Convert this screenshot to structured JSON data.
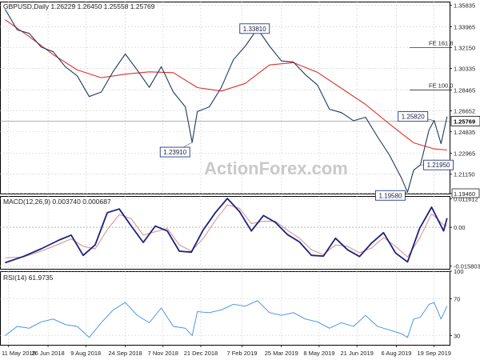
{
  "header": {
    "price_title": "GBPUSD,Daily  1.26229 1.26450 1.25558 1.25769",
    "macd_title": "MACD(12,26,9) 0.003740 0.000687",
    "rsi_title": "RSI(14) 61.9735"
  },
  "watermark": "ActionForex.com",
  "colors": {
    "price": "#1f3a5f",
    "sma": "#e0302a",
    "macd_line": "#1a237e",
    "macd_signal": "#d98b8b",
    "rsi": "#3a8ee6",
    "grid": "#cfcfcf",
    "label_border": "#1f3a8a"
  },
  "chart_data": [
    {
      "type": "line",
      "panel": "price",
      "title": "GBPUSD,Daily",
      "ohlc_last": {
        "open": 1.26229,
        "high": 1.2645,
        "low": 1.25558,
        "close": 1.25769
      },
      "ylim": [
        1.1946,
        1.3616
      ],
      "y_ticks": [
        "1.35835",
        "1.33965",
        "1.32150",
        "1.30335",
        "1.28465",
        "1.26652",
        "1.24835",
        "1.22965",
        "1.21150",
        "1.19460"
      ],
      "y_tick_values": [
        1.35835,
        1.33965,
        1.3215,
        1.30335,
        1.28465,
        1.26652,
        1.24835,
        1.22965,
        1.2115,
        1.1946
      ],
      "last_value_label": "1.25769",
      "x_tick_labels": [
        "11 May 2018",
        "26 Jun 2018",
        "9 Aug 2018",
        "24 Sep 2018",
        "7 Nov 2018",
        "21 Dec 2018",
        "7 Feb 2019",
        "25 Mar 2019",
        "8 May 2019",
        "21 Jun 2019",
        "6 Aug 2019",
        "19 Sep 2019"
      ],
      "x_tick_dates": [
        "2018-05-11",
        "2018-06-26",
        "2018-08-09",
        "2018-09-24",
        "2018-11-07",
        "2018-12-21",
        "2019-02-07",
        "2019-03-25",
        "2019-05-08",
        "2019-06-21",
        "2019-08-06",
        "2019-09-19"
      ],
      "series": [
        {
          "key": "price",
          "x": [
            "2018-05-07",
            "2018-05-21",
            "2018-06-04",
            "2018-06-18",
            "2018-07-02",
            "2018-07-16",
            "2018-07-30",
            "2018-08-13",
            "2018-08-27",
            "2018-09-10",
            "2018-09-24",
            "2018-10-08",
            "2018-10-22",
            "2018-11-05",
            "2018-11-19",
            "2018-12-03",
            "2018-12-11",
            "2018-12-17",
            "2018-12-31",
            "2019-01-14",
            "2019-01-28",
            "2019-02-11",
            "2019-02-25",
            "2019-03-11",
            "2019-03-25",
            "2019-04-08",
            "2019-04-22",
            "2019-05-06",
            "2019-05-20",
            "2019-06-03",
            "2019-06-17",
            "2019-07-01",
            "2019-07-15",
            "2019-07-29",
            "2019-08-12",
            "2019-08-19",
            "2019-08-26",
            "2019-09-03",
            "2019-09-13",
            "2019-09-19",
            "2019-09-27",
            "2019-10-04"
          ],
          "values": [
            1.355,
            1.337,
            1.334,
            1.322,
            1.318,
            1.305,
            1.297,
            1.279,
            1.283,
            1.301,
            1.316,
            1.302,
            1.287,
            1.305,
            1.283,
            1.27,
            1.2391,
            1.266,
            1.27,
            1.287,
            1.311,
            1.323,
            1.3381,
            1.323,
            1.31,
            1.309,
            1.298,
            1.289,
            1.268,
            1.265,
            1.258,
            1.261,
            1.244,
            1.228,
            1.208,
            1.1958,
            1.215,
            1.2195,
            1.25,
            1.2582,
            1.238,
            1.2615
          ]
        },
        {
          "key": "sma",
          "x": [
            "2018-05-07",
            "2018-06-04",
            "2018-07-02",
            "2018-07-30",
            "2018-08-27",
            "2018-09-24",
            "2018-10-22",
            "2018-11-19",
            "2018-12-17",
            "2019-01-14",
            "2019-02-11",
            "2019-03-11",
            "2019-04-08",
            "2019-05-06",
            "2019-06-03",
            "2019-07-01",
            "2019-07-29",
            "2019-08-26",
            "2019-09-19",
            "2019-10-04"
          ],
          "values": [
            1.3458,
            1.3312,
            1.3155,
            1.3022,
            1.2954,
            1.2985,
            1.3005,
            1.2998,
            1.2868,
            1.2838,
            1.2905,
            1.3065,
            1.3085,
            1.3001,
            1.2861,
            1.2722,
            1.2551,
            1.2388,
            1.2335,
            1.2325
          ]
        }
      ],
      "annotations": [
        {
          "label": "1.33810",
          "date": "2019-02-25",
          "value": 1.3381
        },
        {
          "label": "1.23910",
          "date": "2018-12-11",
          "value": 1.2391
        },
        {
          "label": "1.25820",
          "date": "2019-09-19",
          "value": 1.2582
        },
        {
          "label": "1.21950",
          "date": "2019-09-03",
          "value": 1.2195
        },
        {
          "label": "1.19580",
          "date": "2019-08-19",
          "value": 1.1958
        }
      ],
      "reference_lines": [
        {
          "label": "FE 161.8",
          "value": 1.3215
        },
        {
          "label": "FE 100.0",
          "value": 1.28465
        },
        {
          "label": "",
          "value": 1.1946,
          "style": "dashed"
        }
      ]
    },
    {
      "type": "line",
      "panel": "macd",
      "title": "MACD(12,26,9)",
      "last_values": {
        "macd": 0.00374,
        "signal": 0.000687
      },
      "ylim": [
        -0.017,
        0.0128
      ],
      "y_ticks": [
        "0.011612",
        "0.00",
        "-0.015803"
      ],
      "y_tick_values": [
        0.011612,
        0.0,
        -0.015803
      ],
      "series": [
        {
          "key": "macd",
          "x": [
            "2018-05-07",
            "2018-05-28",
            "2018-06-18",
            "2018-07-09",
            "2018-07-23",
            "2018-08-06",
            "2018-08-20",
            "2018-09-03",
            "2018-09-17",
            "2018-10-01",
            "2018-10-15",
            "2018-10-29",
            "2018-11-12",
            "2018-11-26",
            "2018-12-10",
            "2018-12-24",
            "2019-01-07",
            "2019-01-21",
            "2019-02-04",
            "2019-02-18",
            "2019-03-04",
            "2019-03-18",
            "2019-04-01",
            "2019-04-15",
            "2019-04-29",
            "2019-05-13",
            "2019-05-27",
            "2019-06-10",
            "2019-06-24",
            "2019-07-08",
            "2019-07-22",
            "2019-08-05",
            "2019-08-19",
            "2019-09-02",
            "2019-09-16",
            "2019-09-30",
            "2019-10-04"
          ],
          "values": [
            -0.0145,
            -0.012,
            -0.0088,
            -0.0052,
            -0.0032,
            -0.0115,
            -0.0072,
            0.006,
            0.0075,
            0.0005,
            -0.0062,
            0.0005,
            -0.0015,
            -0.0098,
            -0.0102,
            -0.001,
            0.006,
            0.0118,
            0.0065,
            -0.0015,
            0.0048,
            0.002,
            -0.003,
            -0.006,
            -0.0115,
            -0.0118,
            -0.0045,
            -0.0092,
            -0.012,
            -0.0065,
            -0.0022,
            -0.0105,
            -0.0142,
            -0.0005,
            0.0082,
            -0.0015,
            0.00374
          ]
        },
        {
          "key": "signal",
          "x": [
            "2018-05-07",
            "2018-05-28",
            "2018-06-18",
            "2018-07-09",
            "2018-07-23",
            "2018-08-06",
            "2018-08-20",
            "2018-09-03",
            "2018-09-17",
            "2018-10-01",
            "2018-10-15",
            "2018-10-29",
            "2018-11-12",
            "2018-11-26",
            "2018-12-10",
            "2018-12-24",
            "2019-01-07",
            "2019-01-21",
            "2019-02-04",
            "2019-02-18",
            "2019-03-04",
            "2019-03-18",
            "2019-04-01",
            "2019-04-15",
            "2019-04-29",
            "2019-05-13",
            "2019-05-27",
            "2019-06-10",
            "2019-06-24",
            "2019-07-08",
            "2019-07-22",
            "2019-08-05",
            "2019-08-19",
            "2019-09-02",
            "2019-09-16",
            "2019-09-30",
            "2019-10-04"
          ],
          "values": [
            -0.0125,
            -0.0122,
            -0.0098,
            -0.0068,
            -0.0048,
            -0.0078,
            -0.0088,
            -0.001,
            0.0052,
            0.0035,
            -0.0032,
            -0.0018,
            -0.0005,
            -0.0072,
            -0.0098,
            -0.0045,
            0.0028,
            0.0092,
            0.0078,
            0.0015,
            0.0025,
            0.0025,
            -0.0012,
            -0.0045,
            -0.0092,
            -0.0112,
            -0.0072,
            -0.0078,
            -0.0105,
            -0.0085,
            -0.0042,
            -0.0078,
            -0.0122,
            -0.0045,
            0.0055,
            0.001,
            0.000687
          ]
        }
      ]
    },
    {
      "type": "line",
      "panel": "rsi",
      "title": "RSI(14)",
      "last_value": 61.9735,
      "ylim": [
        20,
        100
      ],
      "y_ticks": [
        "100",
        "70",
        "30",
        "0"
      ],
      "y_tick_values": [
        100,
        70,
        30,
        0
      ],
      "series": [
        {
          "key": "rsi",
          "x": [
            "2018-05-07",
            "2018-05-21",
            "2018-06-04",
            "2018-06-18",
            "2018-07-02",
            "2018-07-16",
            "2018-07-30",
            "2018-08-13",
            "2018-08-27",
            "2018-09-10",
            "2018-09-24",
            "2018-10-08",
            "2018-10-22",
            "2018-11-05",
            "2018-11-19",
            "2018-12-03",
            "2018-12-11",
            "2018-12-17",
            "2018-12-31",
            "2019-01-14",
            "2019-01-28",
            "2019-02-11",
            "2019-02-25",
            "2019-03-11",
            "2019-03-25",
            "2019-04-08",
            "2019-04-22",
            "2019-05-06",
            "2019-05-20",
            "2019-06-03",
            "2019-06-17",
            "2019-07-01",
            "2019-07-15",
            "2019-07-29",
            "2019-08-12",
            "2019-08-19",
            "2019-08-26",
            "2019-09-03",
            "2019-09-13",
            "2019-09-19",
            "2019-09-27",
            "2019-10-04"
          ],
          "values": [
            30,
            40,
            38,
            45,
            48,
            42,
            40,
            28,
            44,
            58,
            66,
            52,
            44,
            60,
            40,
            38,
            30,
            56,
            55,
            58,
            64,
            62,
            68,
            55,
            52,
            55,
            48,
            45,
            38,
            44,
            40,
            52,
            40,
            36,
            32,
            28,
            48,
            50,
            64,
            66,
            48,
            62
          ]
        }
      ]
    }
  ]
}
